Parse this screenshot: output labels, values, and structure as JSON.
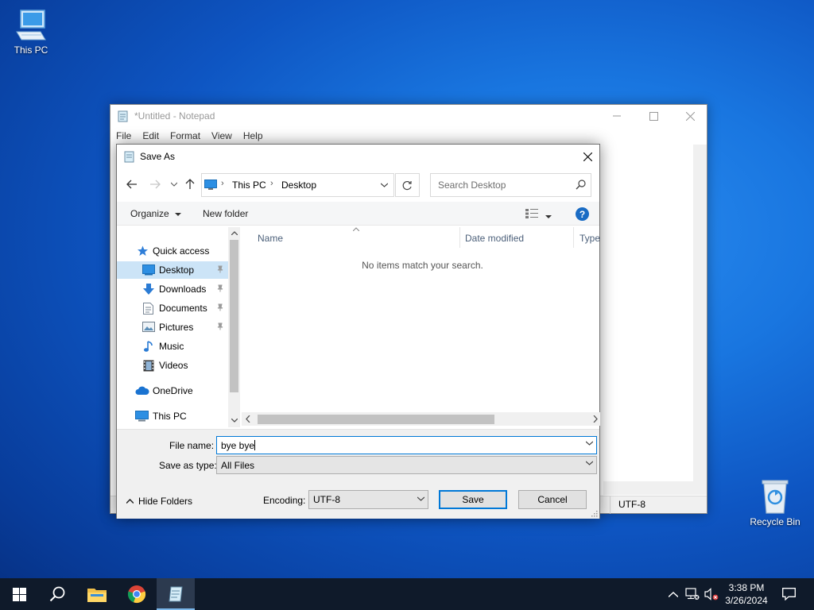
{
  "desktop": {
    "icons": [
      {
        "label": "This PC"
      },
      {
        "label": "Recycle Bin"
      }
    ]
  },
  "notepad": {
    "title": "*Untitled - Notepad",
    "menu": [
      "File",
      "Edit",
      "Format",
      "View",
      "Help"
    ],
    "status_encoding": "UTF-8"
  },
  "dialog": {
    "title": "Save As",
    "address": {
      "crumbs": [
        "This PC",
        "Desktop"
      ]
    },
    "search_placeholder": "Search Desktop",
    "commands": {
      "organize": "Organize",
      "new_folder": "New folder"
    },
    "nav_items": [
      {
        "label": "Quick access",
        "icon": "star-icon"
      },
      {
        "label": "Desktop",
        "icon": "desktop-folder-icon",
        "pinned": true,
        "selected": true
      },
      {
        "label": "Downloads",
        "icon": "download-arrow-icon",
        "pinned": true
      },
      {
        "label": "Documents",
        "icon": "document-icon",
        "pinned": true
      },
      {
        "label": "Pictures",
        "icon": "picture-icon",
        "pinned": true
      },
      {
        "label": "Music",
        "icon": "music-note-icon"
      },
      {
        "label": "Videos",
        "icon": "film-icon"
      },
      {
        "label": "OneDrive",
        "icon": "cloud-icon"
      },
      {
        "label": "This PC",
        "icon": "computer-icon"
      }
    ],
    "columns": [
      "Name",
      "Date modified",
      "Type"
    ],
    "empty_message": "No items match your search.",
    "file_name_label": "File name:",
    "file_name_value": "bye bye",
    "save_type_label": "Save as type:",
    "save_type_value": "All Files",
    "hide_folders": "Hide Folders",
    "encoding_label": "Encoding:",
    "encoding_value": "UTF-8",
    "save_button": "Save",
    "cancel_button": "Cancel"
  },
  "taskbar": {
    "time": "3:38 PM",
    "date": "3/26/2024"
  },
  "colors": {
    "accent": "#0078d7",
    "selection": "#cce4f7",
    "taskbar": "#0f1a2a"
  }
}
